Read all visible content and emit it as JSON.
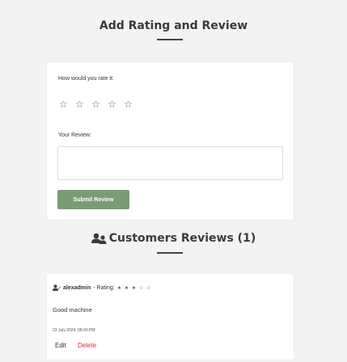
{
  "page": {
    "title": "Add Rating and Review"
  },
  "rating_form": {
    "question": "How would you rate it:",
    "stars": [
      "☆",
      "☆",
      "☆",
      "☆",
      "☆"
    ],
    "rating_value": 0,
    "review_label": "Your Review:",
    "review_value": "",
    "review_placeholder": "",
    "submit_label": "Submit Review",
    "submit_color": "#7a9c75"
  },
  "reviews_section": {
    "title": "Customers Reviews (1)",
    "icon": "users-icon",
    "items": [
      {
        "author": "alexadmin",
        "rating_prefix": "- Rating:",
        "stars": "★ ★ ★ ☆ ☆",
        "rating_value": 3,
        "text": "Good machine",
        "timestamp": "23 July 2024, 08:43 PM",
        "edit_label": "Edit",
        "delete_label": "Delete",
        "delete_color": "#d6334a"
      }
    ]
  }
}
